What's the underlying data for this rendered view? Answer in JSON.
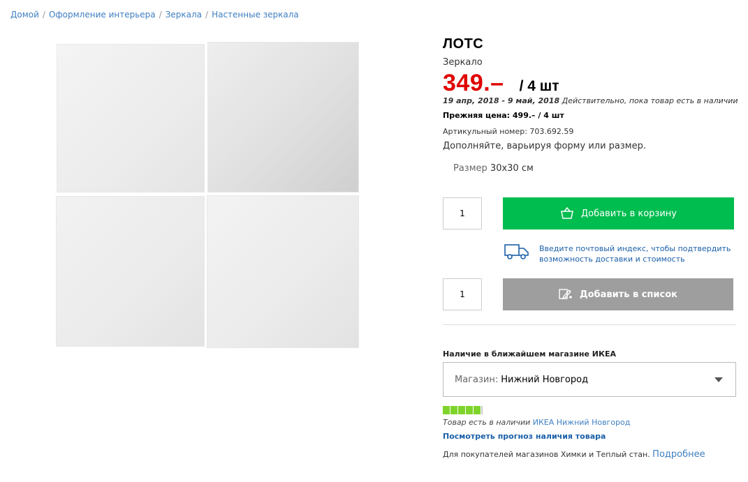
{
  "breadcrumb": {
    "items": [
      "Домой",
      "Оформление интерьера",
      "Зеркала",
      "Настенные зеркала"
    ],
    "separator": "/"
  },
  "product": {
    "name": "ЛОТС",
    "type": "Зеркало",
    "price": "349.–",
    "unit": "/ 4 шт",
    "validity_dates": "19 апр, 2018 - 9 май, 2018",
    "validity_note": "Действительно, пока товар есть в наличии",
    "old_price": "Прежняя цена: 499.– / 4 шт",
    "article": "Артикульный номер: 703.692.59",
    "description": "Дополняйте, варьируя форму или размер.",
    "size_label": "Размер",
    "size_value": "30x30 см",
    "price_color": "#e00000"
  },
  "cart": {
    "quantity": "1",
    "button_label": "Добавить в корзину",
    "button_icon": "basket-icon",
    "button_color": "#00bd4f"
  },
  "delivery": {
    "icon": "truck-icon",
    "text": "Введите почтовый индекс, чтобы подтвердить возможность доставки и стоимость"
  },
  "list": {
    "quantity": "1",
    "button_label": "Добавить в список",
    "button_icon": "list-edit-icon",
    "button_color": "#9e9e9e"
  },
  "availability": {
    "heading": "Наличие в ближайшем магазине ИКЕА",
    "store_label": "Магазин:",
    "store_value": "Нижний Новгород",
    "stock_level": 0.83,
    "stock_color": "#7fd42b",
    "status_text": "Товар есть в наличии",
    "status_store": "ИКЕА Нижний Новгород",
    "forecast_link": "Посмотреть прогноз наличия товара",
    "note_text": "Для покупателей магазинов Химки и Теплый стан.",
    "note_link": "Подробнее"
  }
}
